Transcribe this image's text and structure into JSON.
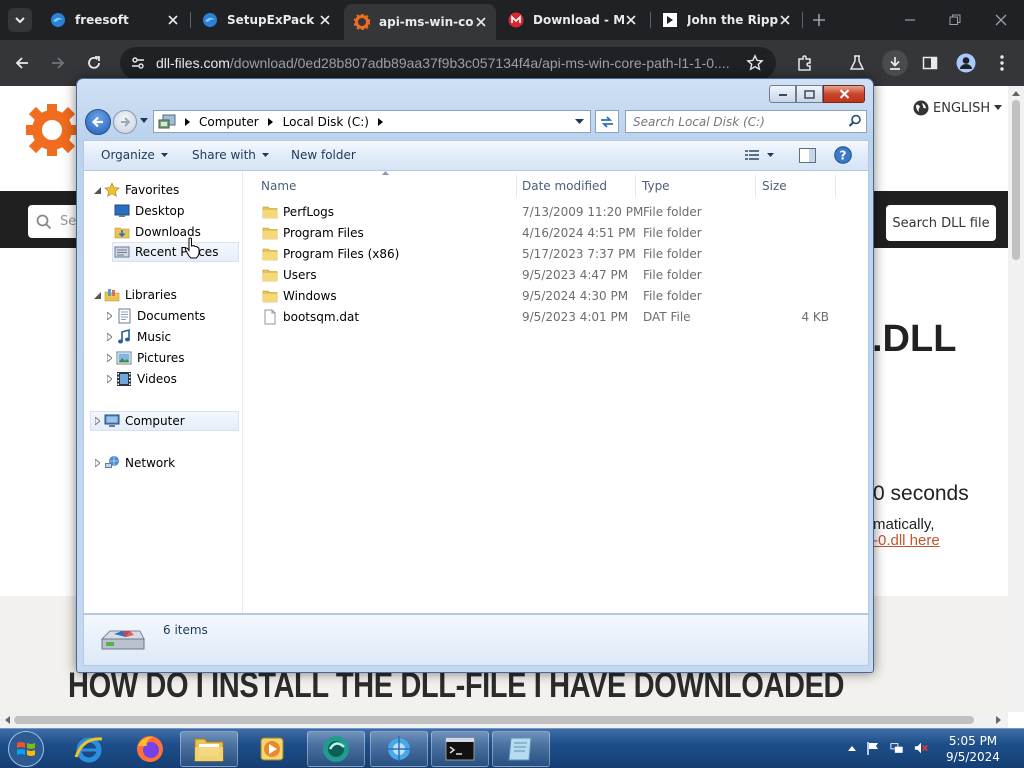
{
  "browser": {
    "tabs": [
      {
        "title": "freesoft",
        "icon": "edge-tab-icon",
        "active": false
      },
      {
        "title": "SetupExPack",
        "icon": "edge-tab-icon",
        "active": false
      },
      {
        "title": "api-ms-win-co",
        "icon": "gear-tab-icon",
        "active": true
      },
      {
        "title": "Download - MI",
        "icon": "mega-tab-icon",
        "active": false
      },
      {
        "title": "John the Rippe",
        "icon": "doc-tab-icon",
        "active": false
      }
    ],
    "url_domain": "dll-files.com",
    "url_path": "/download/0ed28b807adb89aa37f9b3c057134f4a/api-ms-win-core-path-l1-1-0...."
  },
  "page": {
    "language": "ENGLISH",
    "search_placeholder": "Se",
    "search_button": "Search DLL file",
    "heading_fragment": ".DLL",
    "countdown_fragment": "0 seconds",
    "auto_fragment": "matically,",
    "link_fragment": "-0.dll here",
    "howto_heading": "HOW DO I INSTALL THE DLL-FILE I HAVE DOWNLOADED"
  },
  "explorer": {
    "breadcrumb": [
      "Computer",
      "Local Disk (C:)"
    ],
    "search_placeholder": "Search Local Disk (C:)",
    "commands": {
      "organize": "Organize",
      "share_with": "Share with",
      "new_folder": "New folder"
    },
    "nav": {
      "favorites": "Favorites",
      "desktop": "Desktop",
      "downloads": "Downloads",
      "recent_places": "Recent Places",
      "libraries": "Libraries",
      "documents": "Documents",
      "music": "Music",
      "pictures": "Pictures",
      "videos": "Videos",
      "computer": "Computer",
      "network": "Network"
    },
    "columns": {
      "name": "Name",
      "date": "Date modified",
      "type": "Type",
      "size": "Size"
    },
    "files": [
      {
        "name": "PerfLogs",
        "date": "7/13/2009 11:20 PM",
        "type": "File folder",
        "size": ""
      },
      {
        "name": "Program Files",
        "date": "4/16/2024 4:51 PM",
        "type": "File folder",
        "size": ""
      },
      {
        "name": "Program Files (x86)",
        "date": "5/17/2023 7:37 PM",
        "type": "File folder",
        "size": ""
      },
      {
        "name": "Users",
        "date": "9/5/2023 4:47 PM",
        "type": "File folder",
        "size": ""
      },
      {
        "name": "Windows",
        "date": "9/5/2024 4:30 PM",
        "type": "File folder",
        "size": ""
      },
      {
        "name": "bootsqm.dat",
        "date": "9/5/2023 4:01 PM",
        "type": "DAT File",
        "size": "4 KB"
      }
    ],
    "status": "6 items"
  },
  "taskbar": {
    "time": "5:05 PM",
    "date": "9/5/2024"
  },
  "colors": {
    "chrome_dark": "#202124",
    "chrome_tab_active": "#35363a",
    "taskbar_blue": "#1d4e89",
    "link_orange": "#c0562f",
    "folder_yellow": "#e9c452"
  }
}
